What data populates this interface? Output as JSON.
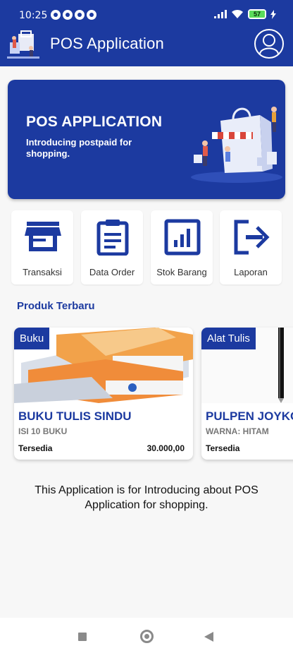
{
  "status_bar": {
    "time": "10:25",
    "battery": "57"
  },
  "app_bar": {
    "title": "POS Application"
  },
  "banner": {
    "title": "POS APPLICATION",
    "subtitle": "Introducing postpaid for shopping."
  },
  "menu": [
    {
      "label": "Transaksi",
      "icon": "store-icon"
    },
    {
      "label": "Data Order",
      "icon": "clipboard-icon"
    },
    {
      "label": "Stok Barang",
      "icon": "bar-chart-icon"
    },
    {
      "label": "Laporan",
      "icon": "logout-icon"
    }
  ],
  "section": {
    "title": "Produk Terbaru"
  },
  "products": [
    {
      "category": "Buku",
      "name": "BUKU TULIS SINDU",
      "desc": "ISI 10 BUKU",
      "status": "Tersedia",
      "price": "30.000,00"
    },
    {
      "category": "Alat Tulis",
      "name": "PULPEN JOYKO",
      "desc": "WARNA: HITAM",
      "status": "Tersedia",
      "price": ""
    }
  ],
  "footer": {
    "text": "This Application is for Introducing about POS Application  for shopping."
  },
  "colors": {
    "primary": "#1c3aa0",
    "background": "#f7f7f7"
  }
}
